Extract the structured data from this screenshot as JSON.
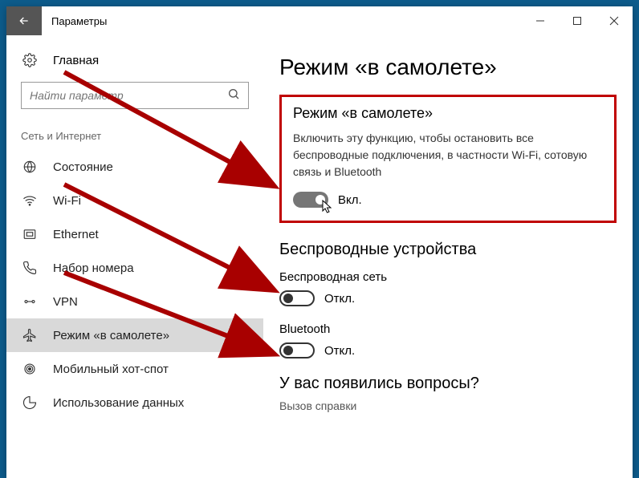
{
  "titlebar": {
    "title": "Параметры"
  },
  "sidebar": {
    "home": "Главная",
    "search_placeholder": "Найти параметр",
    "section": "Сеть и Интернет",
    "items": [
      {
        "label": "Состояние"
      },
      {
        "label": "Wi-Fi"
      },
      {
        "label": "Ethernet"
      },
      {
        "label": "Набор номера"
      },
      {
        "label": "VPN"
      },
      {
        "label": "Режим «в самолете»"
      },
      {
        "label": "Мобильный хот-спот"
      },
      {
        "label": "Использование данных"
      }
    ]
  },
  "content": {
    "page_title": "Режим «в самолете»",
    "airplane": {
      "title": "Режим «в самолете»",
      "desc": "Включить эту функцию, чтобы остановить все беспроводные подключения, в частности Wi-Fi, сотовую связь и Bluetooth",
      "state_label": "Вкл."
    },
    "wireless": {
      "title": "Беспроводные устройства",
      "wifi_label": "Беспроводная сеть",
      "wifi_state": "Откл.",
      "bt_label": "Bluetooth",
      "bt_state": "Откл."
    },
    "help": {
      "title": "У вас появились вопросы?",
      "link": "Вызов справки"
    }
  }
}
